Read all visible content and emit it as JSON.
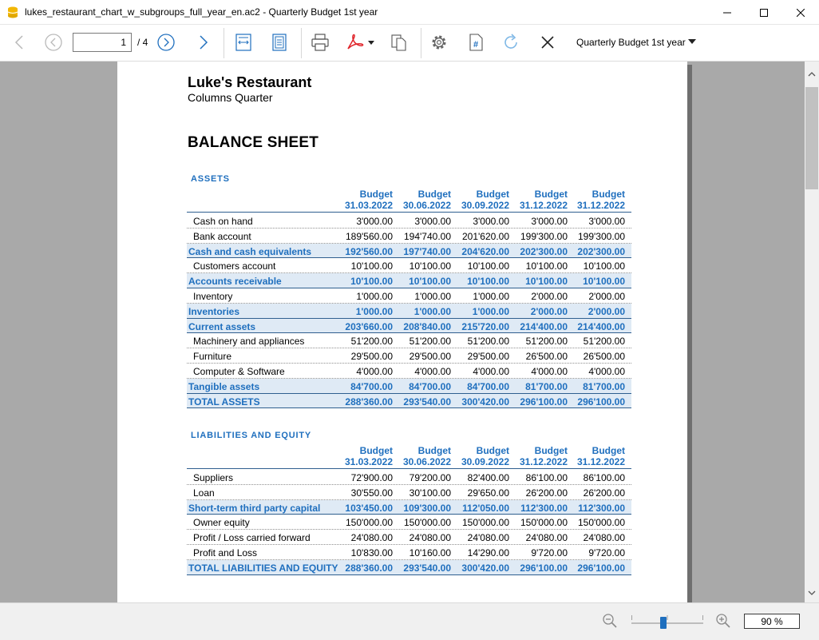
{
  "window": {
    "title": "lukes_restaurant_chart_w_subgroups_full_year_en.ac2 - Quarterly Budget 1st year"
  },
  "toolbar": {
    "page_value": "1",
    "page_total": "/ 4",
    "report_name": "Quarterly Budget 1st year",
    "icons": [
      "arrow-left-icon",
      "circle-left-icon",
      "circle-right-icon",
      "arrow-right-icon",
      "fit-width-icon",
      "fit-page-icon",
      "printer-icon",
      "pdf-icon",
      "copy-icon",
      "gear-icon",
      "hash-document-icon",
      "refresh-icon",
      "close-icon"
    ]
  },
  "report": {
    "company": "Luke's Restaurant",
    "subtitle": "Columns Quarter",
    "title": "BALANCE SHEET",
    "columns": [
      {
        "label": "Budget",
        "date": "31.03.2022"
      },
      {
        "label": "Budget",
        "date": "30.06.2022"
      },
      {
        "label": "Budget",
        "date": "30.09.2022"
      },
      {
        "label": "Budget",
        "date": "31.12.2022"
      },
      {
        "label": "Budget",
        "date": "31.12.2022"
      }
    ],
    "assets": {
      "title": "ASSETS",
      "rows": [
        {
          "desc": "Cash on hand",
          "values": [
            "3'000.00",
            "3'000.00",
            "3'000.00",
            "3'000.00",
            "3'000.00"
          ],
          "type": "normal"
        },
        {
          "desc": "Bank account",
          "values": [
            "189'560.00",
            "194'740.00",
            "201'620.00",
            "199'300.00",
            "199'300.00"
          ],
          "type": "normal"
        },
        {
          "desc": "Cash and cash equivalents",
          "values": [
            "192'560.00",
            "197'740.00",
            "204'620.00",
            "202'300.00",
            "202'300.00"
          ],
          "type": "total"
        },
        {
          "desc": "Customers account",
          "values": [
            "10'100.00",
            "10'100.00",
            "10'100.00",
            "10'100.00",
            "10'100.00"
          ],
          "type": "normal"
        },
        {
          "desc": "Accounts receivable",
          "values": [
            "10'100.00",
            "10'100.00",
            "10'100.00",
            "10'100.00",
            "10'100.00"
          ],
          "type": "total"
        },
        {
          "desc": "Inventory",
          "values": [
            "1'000.00",
            "1'000.00",
            "1'000.00",
            "2'000.00",
            "2'000.00"
          ],
          "type": "normal"
        },
        {
          "desc": "Inventories",
          "values": [
            "1'000.00",
            "1'000.00",
            "1'000.00",
            "2'000.00",
            "2'000.00"
          ],
          "type": "total"
        },
        {
          "desc": "Current assets",
          "values": [
            "203'660.00",
            "208'840.00",
            "215'720.00",
            "214'400.00",
            "214'400.00"
          ],
          "type": "total"
        },
        {
          "desc": "Machinery and appliances",
          "values": [
            "51'200.00",
            "51'200.00",
            "51'200.00",
            "51'200.00",
            "51'200.00"
          ],
          "type": "normal"
        },
        {
          "desc": "Furniture",
          "values": [
            "29'500.00",
            "29'500.00",
            "29'500.00",
            "26'500.00",
            "26'500.00"
          ],
          "type": "normal"
        },
        {
          "desc": "Computer & Software",
          "values": [
            "4'000.00",
            "4'000.00",
            "4'000.00",
            "4'000.00",
            "4'000.00"
          ],
          "type": "normal"
        },
        {
          "desc": "Tangible assets",
          "values": [
            "84'700.00",
            "84'700.00",
            "84'700.00",
            "81'700.00",
            "81'700.00"
          ],
          "type": "total"
        },
        {
          "desc": "TOTAL ASSETS",
          "values": [
            "288'360.00",
            "293'540.00",
            "300'420.00",
            "296'100.00",
            "296'100.00"
          ],
          "type": "grand"
        }
      ]
    },
    "liabilities": {
      "title": "LIABILITIES AND EQUITY",
      "rows": [
        {
          "desc": "Suppliers",
          "values": [
            "72'900.00",
            "79'200.00",
            "82'400.00",
            "86'100.00",
            "86'100.00"
          ],
          "type": "normal"
        },
        {
          "desc": "Loan",
          "values": [
            "30'550.00",
            "30'100.00",
            "29'650.00",
            "26'200.00",
            "26'200.00"
          ],
          "type": "normal"
        },
        {
          "desc": "Short-term third party capital",
          "values": [
            "103'450.00",
            "109'300.00",
            "112'050.00",
            "112'300.00",
            "112'300.00"
          ],
          "type": "total"
        },
        {
          "desc": "Owner equity",
          "values": [
            "150'000.00",
            "150'000.00",
            "150'000.00",
            "150'000.00",
            "150'000.00"
          ],
          "type": "normal"
        },
        {
          "desc": "Profit / Loss carried forward",
          "values": [
            "24'080.00",
            "24'080.00",
            "24'080.00",
            "24'080.00",
            "24'080.00"
          ],
          "type": "normal"
        },
        {
          "desc": "Profit and Loss",
          "values": [
            "10'830.00",
            "10'160.00",
            "14'290.00",
            "9'720.00",
            "9'720.00"
          ],
          "type": "normal"
        },
        {
          "desc": "TOTAL LIABILITIES AND EQUITY",
          "values": [
            "288'360.00",
            "293'540.00",
            "300'420.00",
            "296'100.00",
            "296'100.00"
          ],
          "type": "grand"
        }
      ]
    }
  },
  "statusbar": {
    "zoom_value": "90  %",
    "zoom_level_percent": 90
  },
  "colors": {
    "accent": "#1f6fbe",
    "total_row_bg": "#dfeaf5",
    "viewer_bg": "#a9a9a9"
  }
}
